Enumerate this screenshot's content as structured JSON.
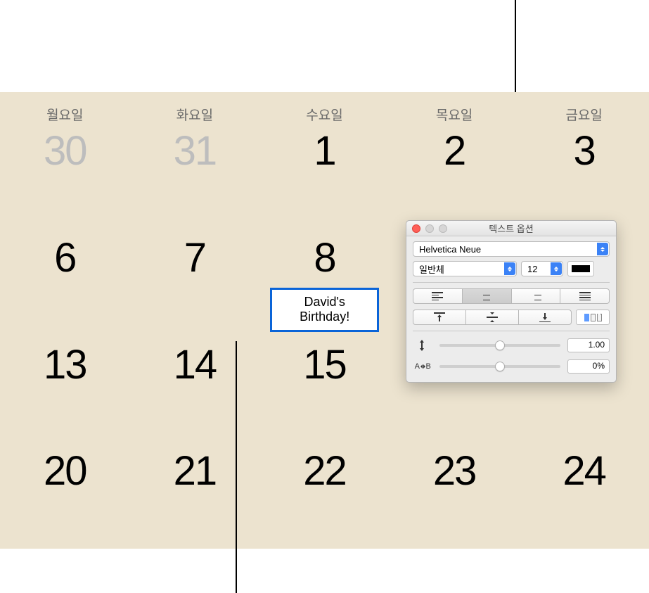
{
  "calendar": {
    "headers": [
      "월요일",
      "화요일",
      "수요일",
      "목요일",
      "금요일"
    ],
    "weeks": [
      [
        {
          "n": "30",
          "faded": true
        },
        {
          "n": "31",
          "faded": true
        },
        {
          "n": "1"
        },
        {
          "n": "2"
        },
        {
          "n": "3"
        }
      ],
      [
        {
          "n": "6"
        },
        {
          "n": "7"
        },
        {
          "n": "8"
        },
        {
          "n": ""
        },
        {
          "n": ""
        }
      ],
      [
        {
          "n": "13"
        },
        {
          "n": "14"
        },
        {
          "n": "15"
        },
        {
          "n": ""
        },
        {
          "n": ""
        }
      ],
      [
        {
          "n": "20"
        },
        {
          "n": "21"
        },
        {
          "n": "22"
        },
        {
          "n": "23"
        },
        {
          "n": "24"
        }
      ]
    ],
    "event": {
      "line1": "David's",
      "line2": "Birthday!"
    }
  },
  "panel": {
    "title": "텍스트 옵션",
    "font_family": "Helvetica Neue",
    "font_style": "일반체",
    "font_size": "12",
    "line_spacing": "1.00",
    "char_spacing": "0%"
  }
}
